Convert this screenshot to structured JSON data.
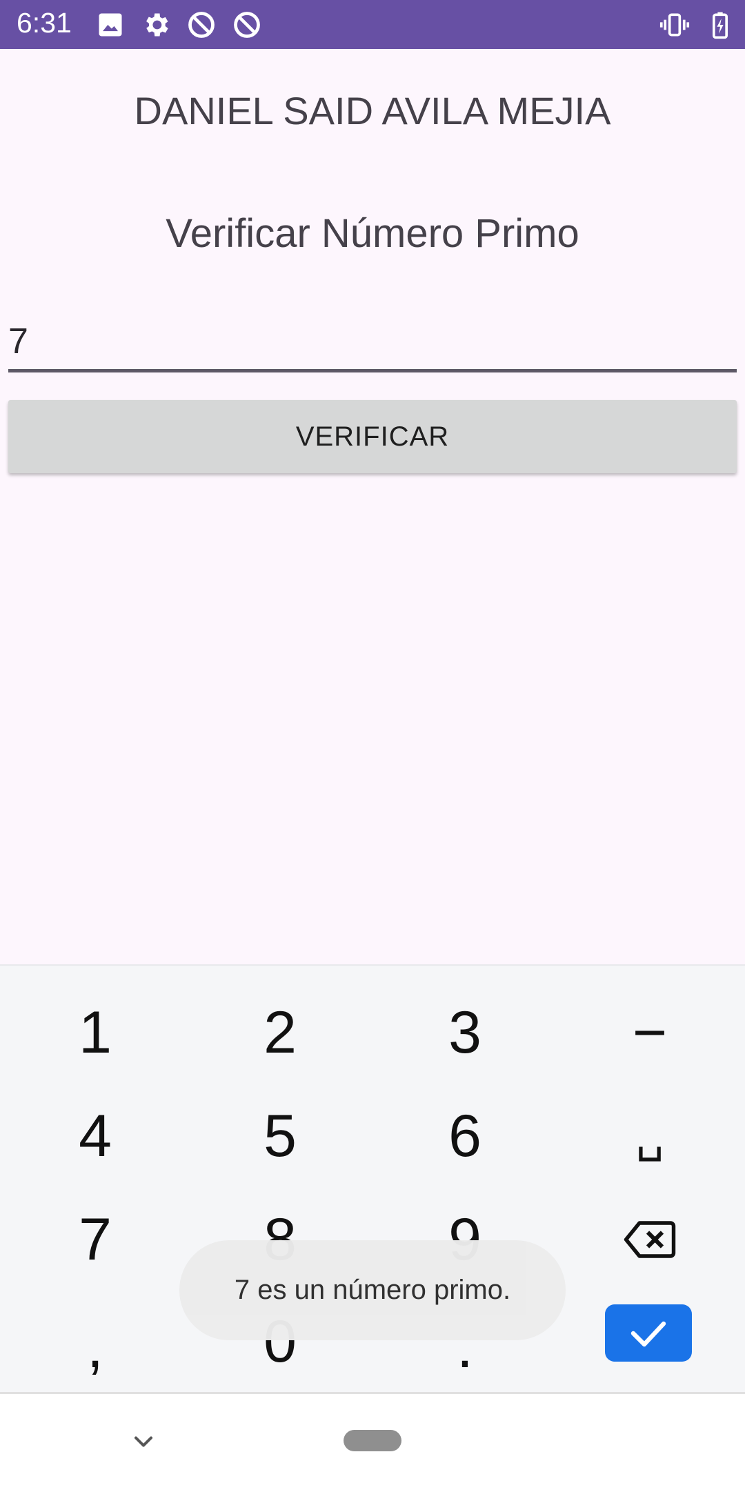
{
  "status_bar": {
    "time": "6:31",
    "icons": [
      "image-icon",
      "gear-icon",
      "blocked-icon",
      "blocked-icon",
      "vibrate-icon",
      "battery-charging-icon"
    ],
    "color": "#6750a4"
  },
  "app": {
    "name_title": "DANIEL SAID AVILA MEJIA",
    "subtitle": "Verificar Número Primo",
    "input_value": "7",
    "verify_button": "VERIFICAR"
  },
  "keyboard": {
    "rows": [
      [
        "1",
        "2",
        "3",
        "−"
      ],
      [
        "4",
        "5",
        "6",
        "␣"
      ],
      [
        "7",
        "8",
        "9",
        "backspace-icon"
      ],
      [
        ",",
        "0",
        ".",
        "check-icon"
      ]
    ],
    "done_color": "#1a73e8"
  },
  "toast": {
    "message": "7 es un número primo."
  },
  "nav": {
    "icons": [
      "chevron-down-icon",
      "home-handle"
    ]
  }
}
